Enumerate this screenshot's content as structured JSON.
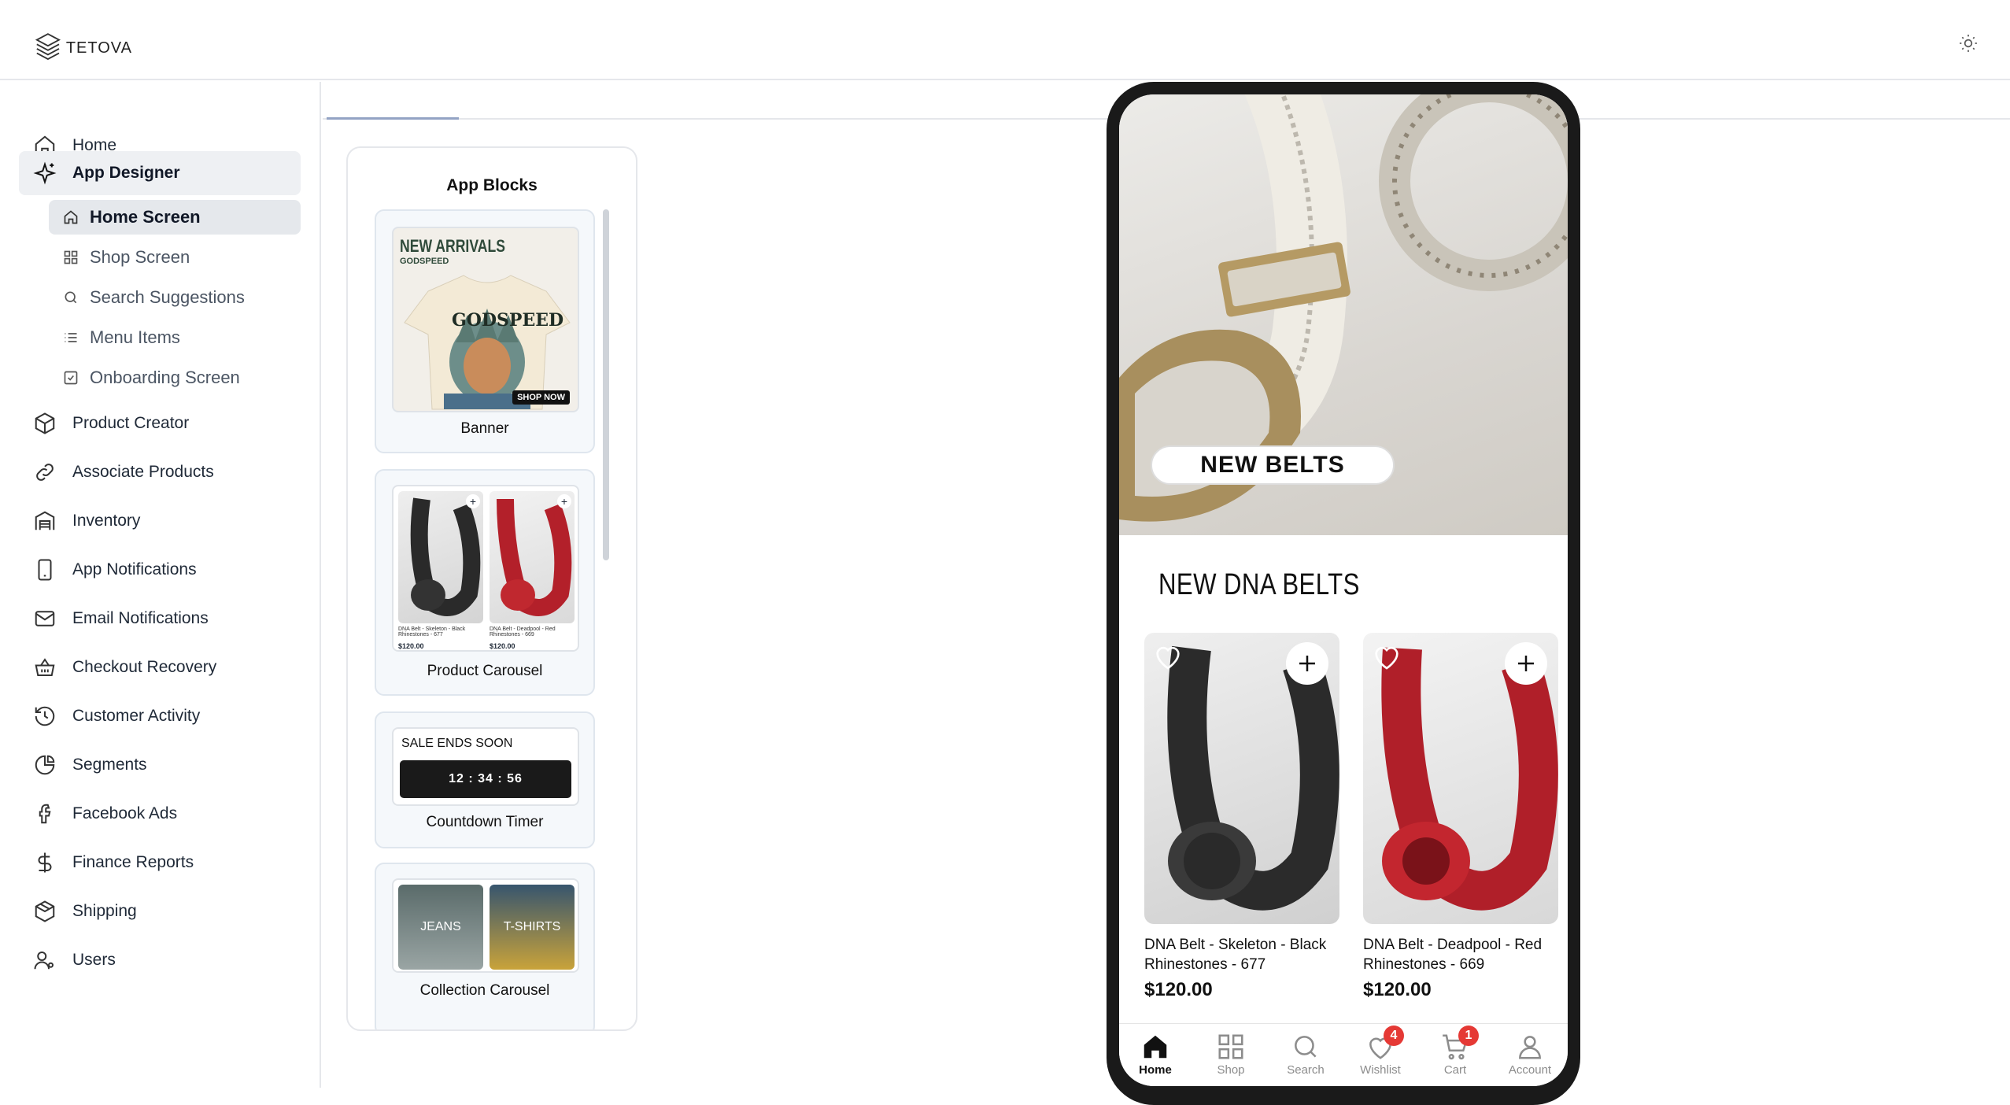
{
  "app": {
    "logo_text": "TETOVA",
    "theme_icon": "sun-icon"
  },
  "sidebar": {
    "items": [
      {
        "label": "Home",
        "icon": "home-icon"
      },
      {
        "label": "App Designer",
        "icon": "sparkle-icon"
      },
      {
        "label": "Product Creator",
        "icon": "box-icon"
      },
      {
        "label": "Associate Products",
        "icon": "link-icon"
      },
      {
        "label": "Inventory",
        "icon": "warehouse-icon"
      },
      {
        "label": "App Notifications",
        "icon": "phone-icon"
      },
      {
        "label": "Email Notifications",
        "icon": "mail-icon"
      },
      {
        "label": "Checkout Recovery",
        "icon": "basket-icon"
      },
      {
        "label": "Customer Activity",
        "icon": "history-icon"
      },
      {
        "label": "Segments",
        "icon": "pie-chart-icon"
      },
      {
        "label": "Facebook Ads",
        "icon": "facebook-icon"
      },
      {
        "label": "Finance Reports",
        "icon": "dollar-icon"
      },
      {
        "label": "Shipping",
        "icon": "package-icon"
      },
      {
        "label": "Users",
        "icon": "users-icon"
      }
    ],
    "sub_items": [
      {
        "label": "Home Screen",
        "icon": "home-icon"
      },
      {
        "label": "Shop Screen",
        "icon": "grid-icon"
      },
      {
        "label": "Search Suggestions",
        "icon": "search-icon"
      },
      {
        "label": "Menu Items",
        "icon": "list-icon"
      },
      {
        "label": "Onboarding Screen",
        "icon": "checkbox-icon"
      }
    ]
  },
  "blocks_panel": {
    "title": "App Blocks",
    "blocks": [
      {
        "label": "Banner"
      },
      {
        "label": "Product Carousel"
      },
      {
        "label": "Countdown Timer"
      },
      {
        "label": "Collection Carousel"
      }
    ],
    "banner_thumb": {
      "headline": "NEW ARRIVALS",
      "brand": "GODSPEED",
      "cta": "SHOP NOW"
    },
    "carousel_thumb": {
      "items": [
        {
          "name": "DNA Belt - Skeleton - Black Rhinestones - 677",
          "price": "$120.00"
        },
        {
          "name": "DNA Belt - Deadpool - Red Rhinestones - 669",
          "price": "$120.00"
        }
      ]
    },
    "timer_thumb": {
      "caption": "SALE ENDS SOON",
      "time": "12 : 34 : 56"
    },
    "collection_thumb": {
      "items": [
        "JEANS",
        "T-SHIRTS"
      ]
    }
  },
  "preview": {
    "hero_badge": "NEW BELTS",
    "section_title": "NEW DNA BELTS",
    "products": [
      {
        "name": "DNA Belt - Skeleton - Black Rhinestones - 677",
        "price": "$120.00"
      },
      {
        "name": "DNA Belt - Deadpool - Red Rhinestones - 669",
        "price": "$120.00"
      }
    ],
    "tabs": [
      {
        "label": "Home",
        "icon": "home-icon",
        "badge": ""
      },
      {
        "label": "Shop",
        "icon": "grid-icon",
        "badge": ""
      },
      {
        "label": "Search",
        "icon": "search-icon",
        "badge": ""
      },
      {
        "label": "Wishlist",
        "icon": "heart-icon",
        "badge": "4"
      },
      {
        "label": "Cart",
        "icon": "cart-icon",
        "badge": "1"
      },
      {
        "label": "Account",
        "icon": "user-icon",
        "badge": ""
      }
    ]
  },
  "colors": {
    "accent": "#93a3c4",
    "badge": "#e53935",
    "active_bg": "#eef0f3"
  }
}
